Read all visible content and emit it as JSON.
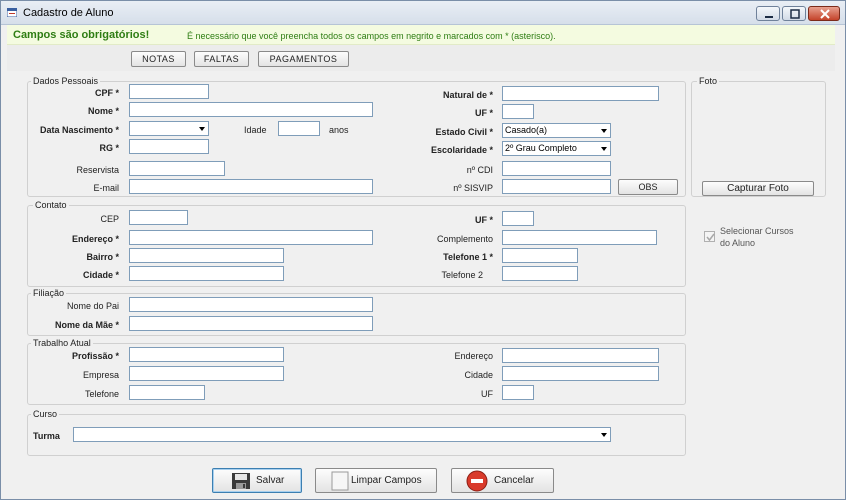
{
  "window": {
    "title": "Cadastro de Aluno"
  },
  "notice": {
    "bold": "Campos são obrigatórios!",
    "text": "É necessário que você preencha todos os campos em negrito e marcados com * (asterisco)."
  },
  "tabs": {
    "notas": "NOTAS",
    "faltas": "FALTAS",
    "pagamentos": "PAGAMENTOS"
  },
  "dados": {
    "legend": "Dados Pessoais",
    "cpf": "CPF *",
    "nome": "Nome *",
    "data_nasc": "Data Nascimento *",
    "idade": "Idade",
    "anos": "anos",
    "rg": "RG *",
    "reservista": "Reservista",
    "email": "E-mail",
    "natural": "Natural de *",
    "uf": "UF *",
    "estado_civil": "Estado Civil *",
    "estado_civil_value": "Casado(a)",
    "escolaridade": "Escolaridade *",
    "escolaridade_value": "2º Grau Completo",
    "cdi": "nº CDI",
    "sisvip": "nº SISVIP",
    "obs": "OBS"
  },
  "foto": {
    "legend": "Foto",
    "capturar": "Capturar Foto"
  },
  "cursos_check": {
    "label_line1": "Selecionar Cursos",
    "label_line2": "do Aluno"
  },
  "contato": {
    "legend": "Contato",
    "cep": "CEP",
    "endereco": "Endereço *",
    "bairro": "Bairro *",
    "cidade": "Cidade *",
    "uf": "UF *",
    "complemento": "Complemento",
    "telefone1": "Telefone 1 *",
    "telefone2": "Telefone 2"
  },
  "filiacao": {
    "legend": "Filiação",
    "pai": "Nome do Pai",
    "mae": "Nome da Mãe *"
  },
  "trabalho": {
    "legend": "Trabalho Atual",
    "profissao": "Profissão *",
    "empresa": "Empresa",
    "telefone": "Telefone",
    "endereco": "Endereço",
    "cidade": "Cidade",
    "uf": "UF"
  },
  "curso": {
    "legend": "Curso",
    "turma": "Turma"
  },
  "actions": {
    "salvar": "Salvar",
    "limpar": "Limpar Campos",
    "cancelar": "Cancelar"
  }
}
